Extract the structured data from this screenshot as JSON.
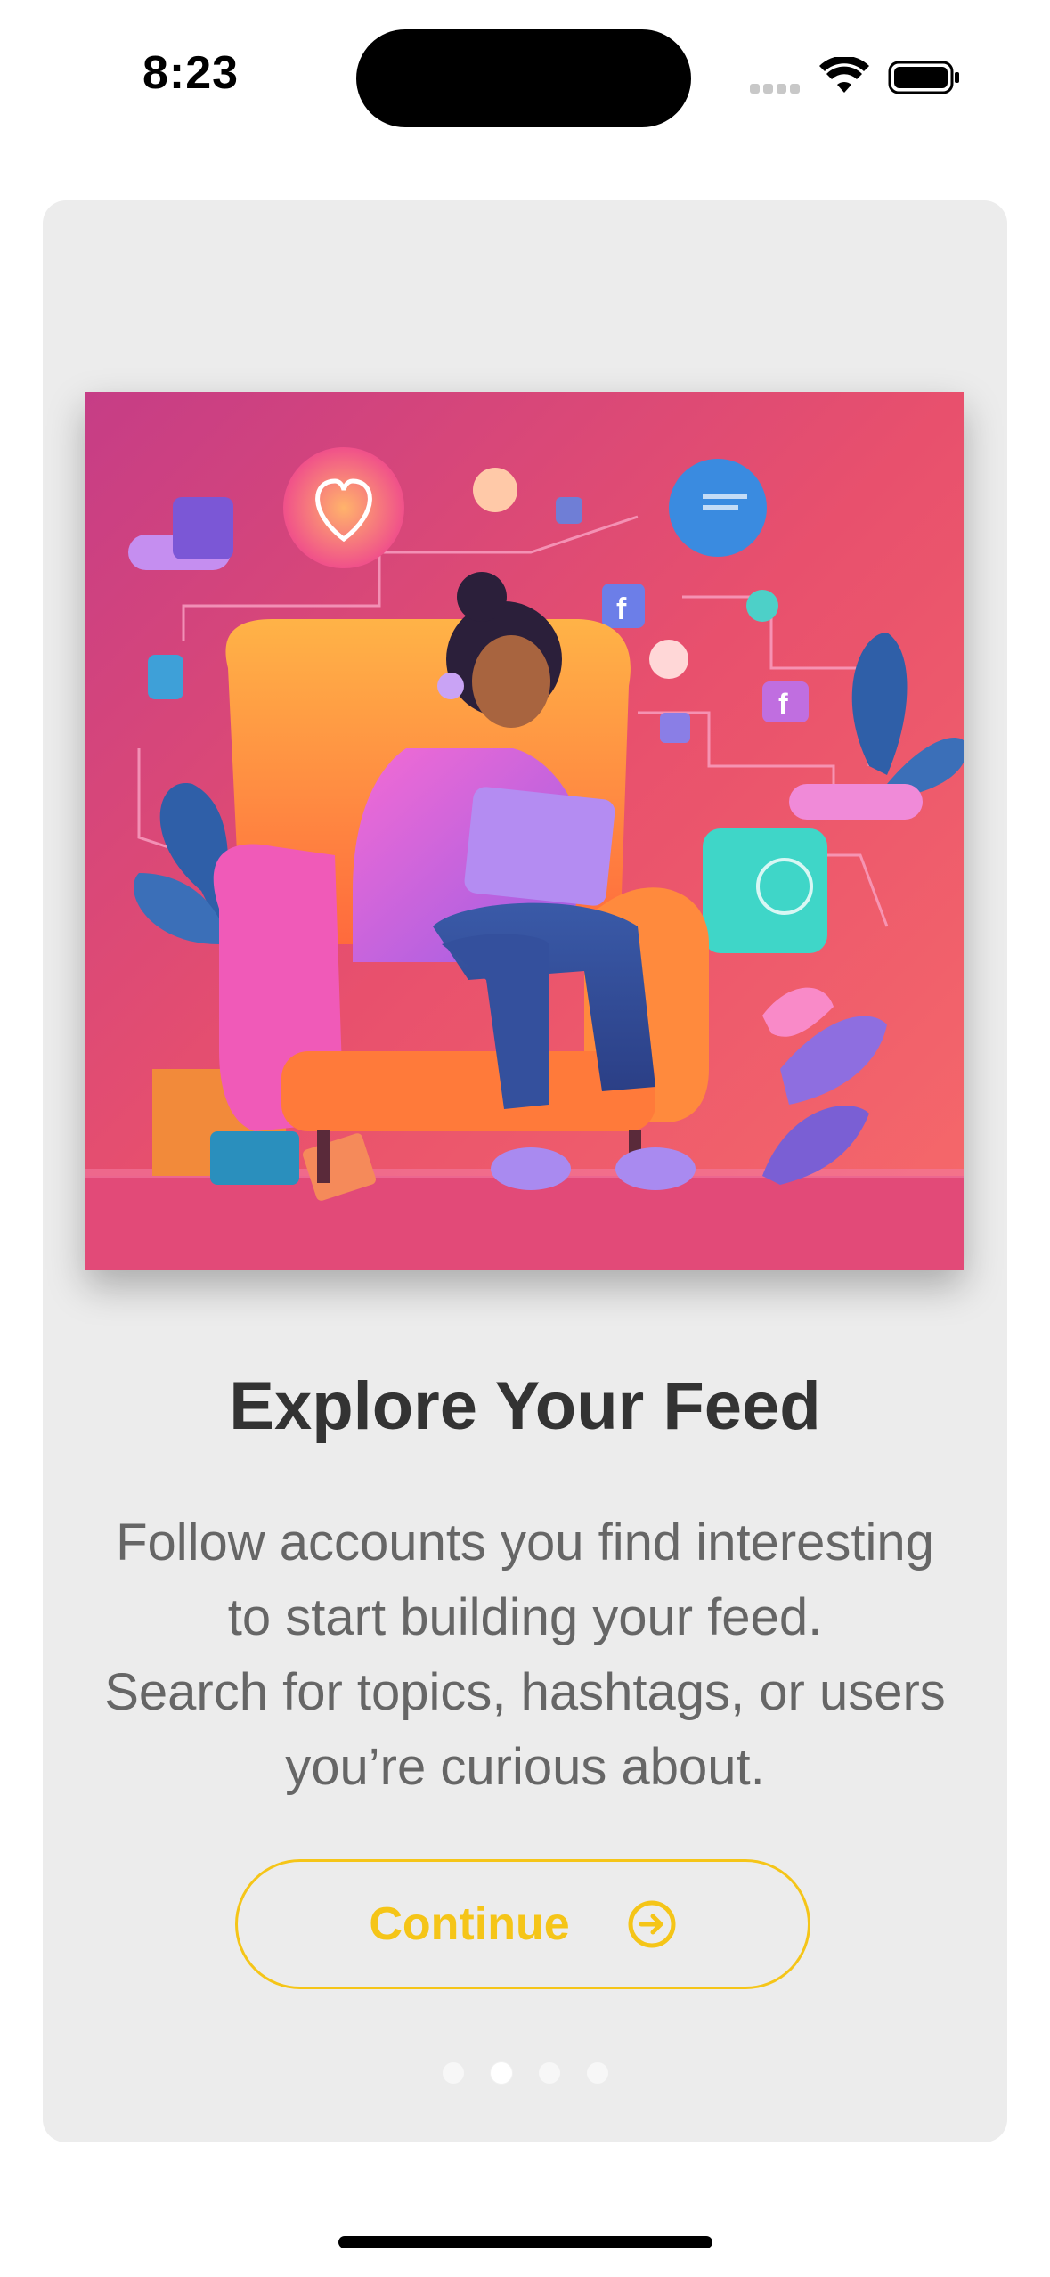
{
  "status_bar": {
    "time": "8:23",
    "wifi_icon": "wifi-icon",
    "battery_icon": "battery-icon",
    "signal_icon": "cellular-signal-icon"
  },
  "onboarding": {
    "image_description_icon": "illustration-woman-armchair-social-media",
    "title": "Explore Your Feed",
    "body_lines": [
      "Follow accounts you find interesting",
      "to start building your feed.",
      "Search for topics, hashtags, or users",
      "you’re curious about."
    ],
    "continue_label": "Continue",
    "continue_icon": "arrow-right-circle-icon",
    "page_count": 4,
    "current_page": 2
  },
  "colors": {
    "accent": "#f5c518",
    "card_background": "#ececec",
    "title": "#333333",
    "body": "#666666"
  }
}
